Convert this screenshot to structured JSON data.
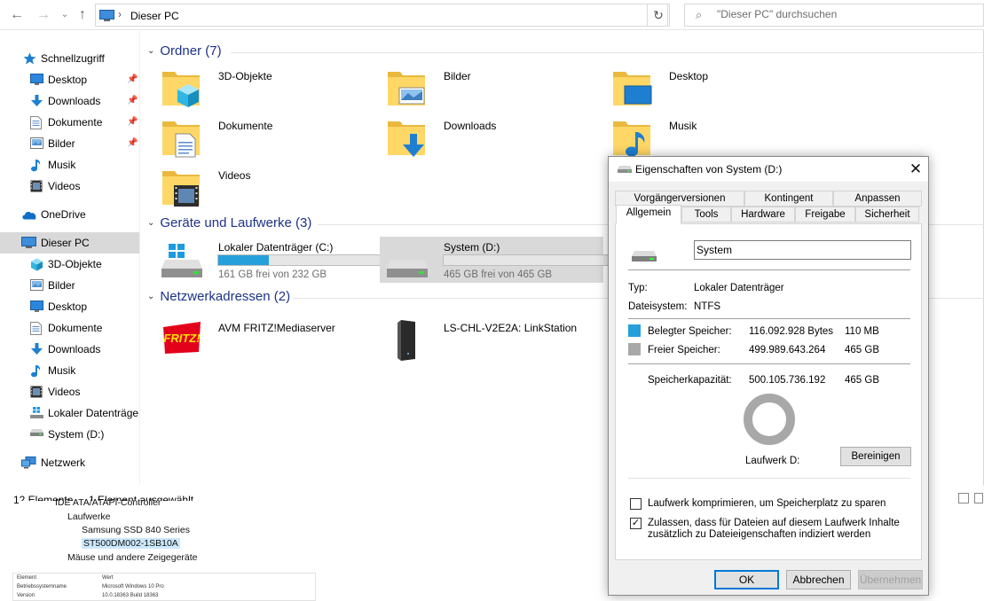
{
  "explorer": {
    "address_path": "Dieser PC",
    "search_placeholder": "\"Dieser PC\" durchsuchen"
  },
  "sidebar": {
    "quick_access": {
      "label": "Schnellzugriff",
      "items": [
        {
          "label": "Desktop",
          "pinned": true,
          "icon": "desktop-icon"
        },
        {
          "label": "Downloads",
          "pinned": true,
          "icon": "downloads-icon"
        },
        {
          "label": "Dokumente",
          "pinned": true,
          "icon": "documents-icon"
        },
        {
          "label": "Bilder",
          "pinned": true,
          "icon": "pictures-icon"
        },
        {
          "label": "Musik",
          "pinned": false,
          "icon": "music-icon"
        },
        {
          "label": "Videos",
          "pinned": false,
          "icon": "videos-icon"
        }
      ]
    },
    "onedrive": "OneDrive",
    "this_pc": {
      "label": "Dieser PC",
      "items": [
        {
          "label": "3D-Objekte",
          "icon": "3d-objects-icon"
        },
        {
          "label": "Bilder",
          "icon": "pictures-icon"
        },
        {
          "label": "Desktop",
          "icon": "desktop-icon"
        },
        {
          "label": "Dokumente",
          "icon": "documents-icon"
        },
        {
          "label": "Downloads",
          "icon": "downloads-icon"
        },
        {
          "label": "Musik",
          "icon": "music-icon"
        },
        {
          "label": "Videos",
          "icon": "videos-icon"
        },
        {
          "label": "Lokaler Datenträger",
          "icon": "windows-drive-icon"
        },
        {
          "label": "System (D:)",
          "icon": "drive-icon"
        }
      ]
    },
    "network": "Netzwerk"
  },
  "content": {
    "folders_header": "Ordner (7)",
    "folders": [
      {
        "name": "3D-Objekte",
        "icon": "3d-objects-folder-icon"
      },
      {
        "name": "Bilder",
        "icon": "pictures-folder-icon"
      },
      {
        "name": "Desktop",
        "icon": "desktop-folder-icon"
      },
      {
        "name": "Dokumente",
        "icon": "documents-folder-icon"
      },
      {
        "name": "Downloads",
        "icon": "downloads-folder-icon"
      },
      {
        "name": "Musik",
        "icon": "music-folder-icon"
      },
      {
        "name": "Videos",
        "icon": "videos-folder-icon"
      }
    ],
    "devices_header": "Geräte und Laufwerke (3)",
    "drives": [
      {
        "name": "Lokaler Datenträger (C:)",
        "free_text": "161 GB frei von 232 GB",
        "used_fraction": 0.306,
        "selected": false
      },
      {
        "name": "System (D:)",
        "free_text": "465 GB frei von 465 GB",
        "used_fraction": 0.0,
        "selected": true
      }
    ],
    "network_header": "Netzwerkadressen (2)",
    "network_items": [
      {
        "name": "AVM FRITZ!Mediaserver",
        "icon": "fritz-logo-icon",
        "logo_text": "FRITZ!"
      },
      {
        "name": "LS-CHL-V2E2A: LinkStation",
        "icon": "nas-icon"
      }
    ]
  },
  "status": {
    "count": "12 Elemente",
    "selection": "1 Element ausgewählt"
  },
  "background_windows": {
    "device_manager_rows": [
      "IDE ATA/ATAPI-Controller",
      "Laufwerke",
      "Samsung SSD 840 Series",
      "ST500DM002-1SB10A",
      "Mäuse und andere Zeigegeräte"
    ],
    "sysinfo_header": [
      "Element",
      "Wert"
    ],
    "sysinfo_rows": [
      [
        "Betriebssystemname",
        "Microsoft Windows 10 Pro"
      ],
      [
        "Version",
        "10.0.18363 Build 18363"
      ]
    ]
  },
  "dialog": {
    "title": "Eigenschaften von System (D:)",
    "tabs_row1": [
      "Vorgängerversionen",
      "Kontingent",
      "Anpassen"
    ],
    "tabs_row2": [
      "Allgemein",
      "Tools",
      "Hardware",
      "Freigabe",
      "Sicherheit"
    ],
    "name_value": "System",
    "type_label": "Typ:",
    "type_value": "Lokaler Datenträger",
    "fs_label": "Dateisystem:",
    "fs_value": "NTFS",
    "used_label": "Belegter Speicher:",
    "used_bytes": "116.092.928 Bytes",
    "used_size": "110 MB",
    "free_label": "Freier Speicher:",
    "free_bytes": "499.989.643.264",
    "free_size": "465 GB",
    "capacity_label": "Speicherkapazität:",
    "capacity_bytes": "500.105.736.192",
    "capacity_size": "465 GB",
    "used_fraction": 0.00023,
    "drive_label": "Laufwerk D:",
    "cleanup_button": "Bereinigen",
    "compress_label": "Laufwerk komprimieren, um Speicherplatz zu sparen",
    "compress_checked": false,
    "index_label": "Zulassen, dass für Dateien auf diesem Laufwerk Inhalte zusätzlich zu Dateieigenschaften indiziert werden",
    "index_checked": true,
    "ok_button": "OK",
    "cancel_button": "Abbrechen",
    "apply_button": "Übernehmen",
    "colors": {
      "used": "#26a0da",
      "free": "#a8a8a8"
    }
  }
}
